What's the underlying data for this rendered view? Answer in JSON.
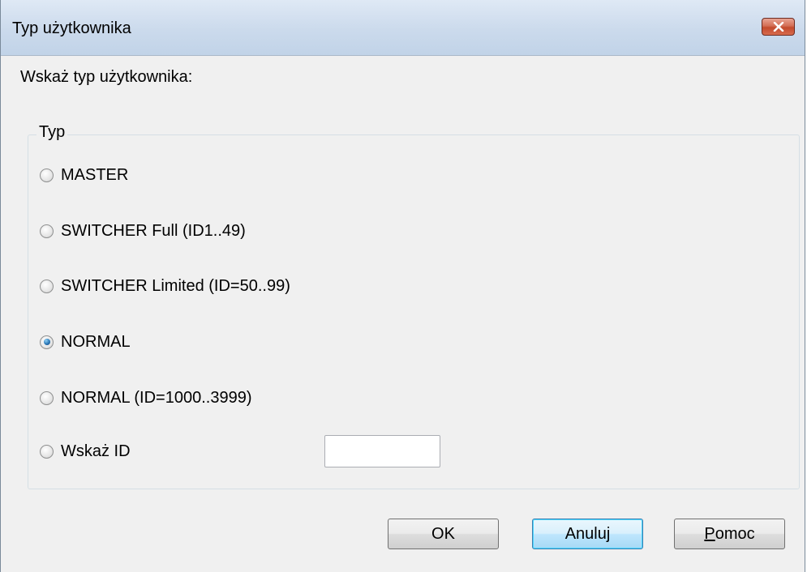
{
  "window": {
    "title": "Typ użytkownika",
    "close_icon": "close-x-icon"
  },
  "instruction": "Wskaż typ użytkownika:",
  "group": {
    "legend": "Typ",
    "options": [
      {
        "label": "MASTER",
        "checked": false
      },
      {
        "label": "SWITCHER Full (ID1..49)",
        "checked": false
      },
      {
        "label": "SWITCHER Limited (ID=50..99)",
        "checked": false
      },
      {
        "label": "NORMAL",
        "checked": true
      },
      {
        "label": "NORMAL (ID=1000..3999)",
        "checked": false
      },
      {
        "label": "Wskaż ID",
        "checked": false
      }
    ],
    "id_input_value": ""
  },
  "buttons": {
    "ok": "OK",
    "cancel": "Anuluj",
    "help_mnemonic": "P",
    "help_rest": "omoc"
  },
  "colors": {
    "selected_radio": "#2b78b7",
    "close_button": "#c34a2c",
    "default_button_border": "#3c7fb1"
  }
}
